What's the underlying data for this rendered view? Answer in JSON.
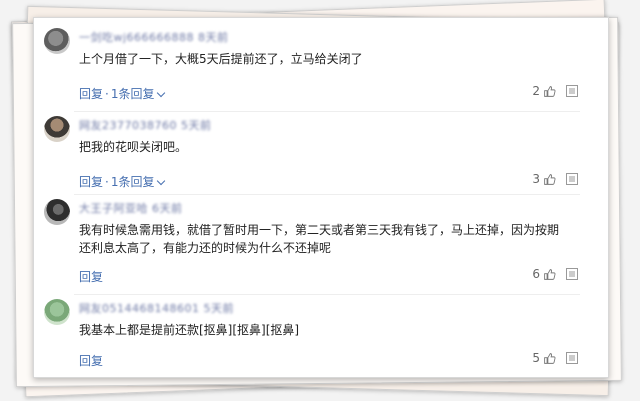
{
  "comments": [
    {
      "username": "一剑吃wj666666888 8天前",
      "text": "上个月借了一下，大概5天后提前还了，立马给关闭了",
      "reply_label": "回复",
      "reply_count_label": "1条回复",
      "likes": "2"
    },
    {
      "username": "网友2377038760 5天前",
      "text": "把我的花呗关闭吧。",
      "reply_label": "回复",
      "reply_count_label": "1条回复",
      "likes": "3"
    },
    {
      "username": "大王子阿亚哈 6天前",
      "text": "我有时候急需用钱，就借了暂时用一下，第二天或者第三天我有钱了，马上还掉，因为按期还利息太高了，有能力还的时候为什么不还掉呢",
      "reply_label": "回复",
      "likes": "6"
    },
    {
      "username": "网友0514468148601 5天前",
      "text": "我基本上都是提前还款[抠鼻][抠鼻][抠鼻]",
      "reply_label": "回复",
      "likes": "5"
    }
  ],
  "colors": {
    "link": "#466fb0",
    "username": "#6f7aa6",
    "text": "#222222"
  },
  "icons": {
    "like": "thumb-up-icon",
    "more": "more-icon"
  }
}
